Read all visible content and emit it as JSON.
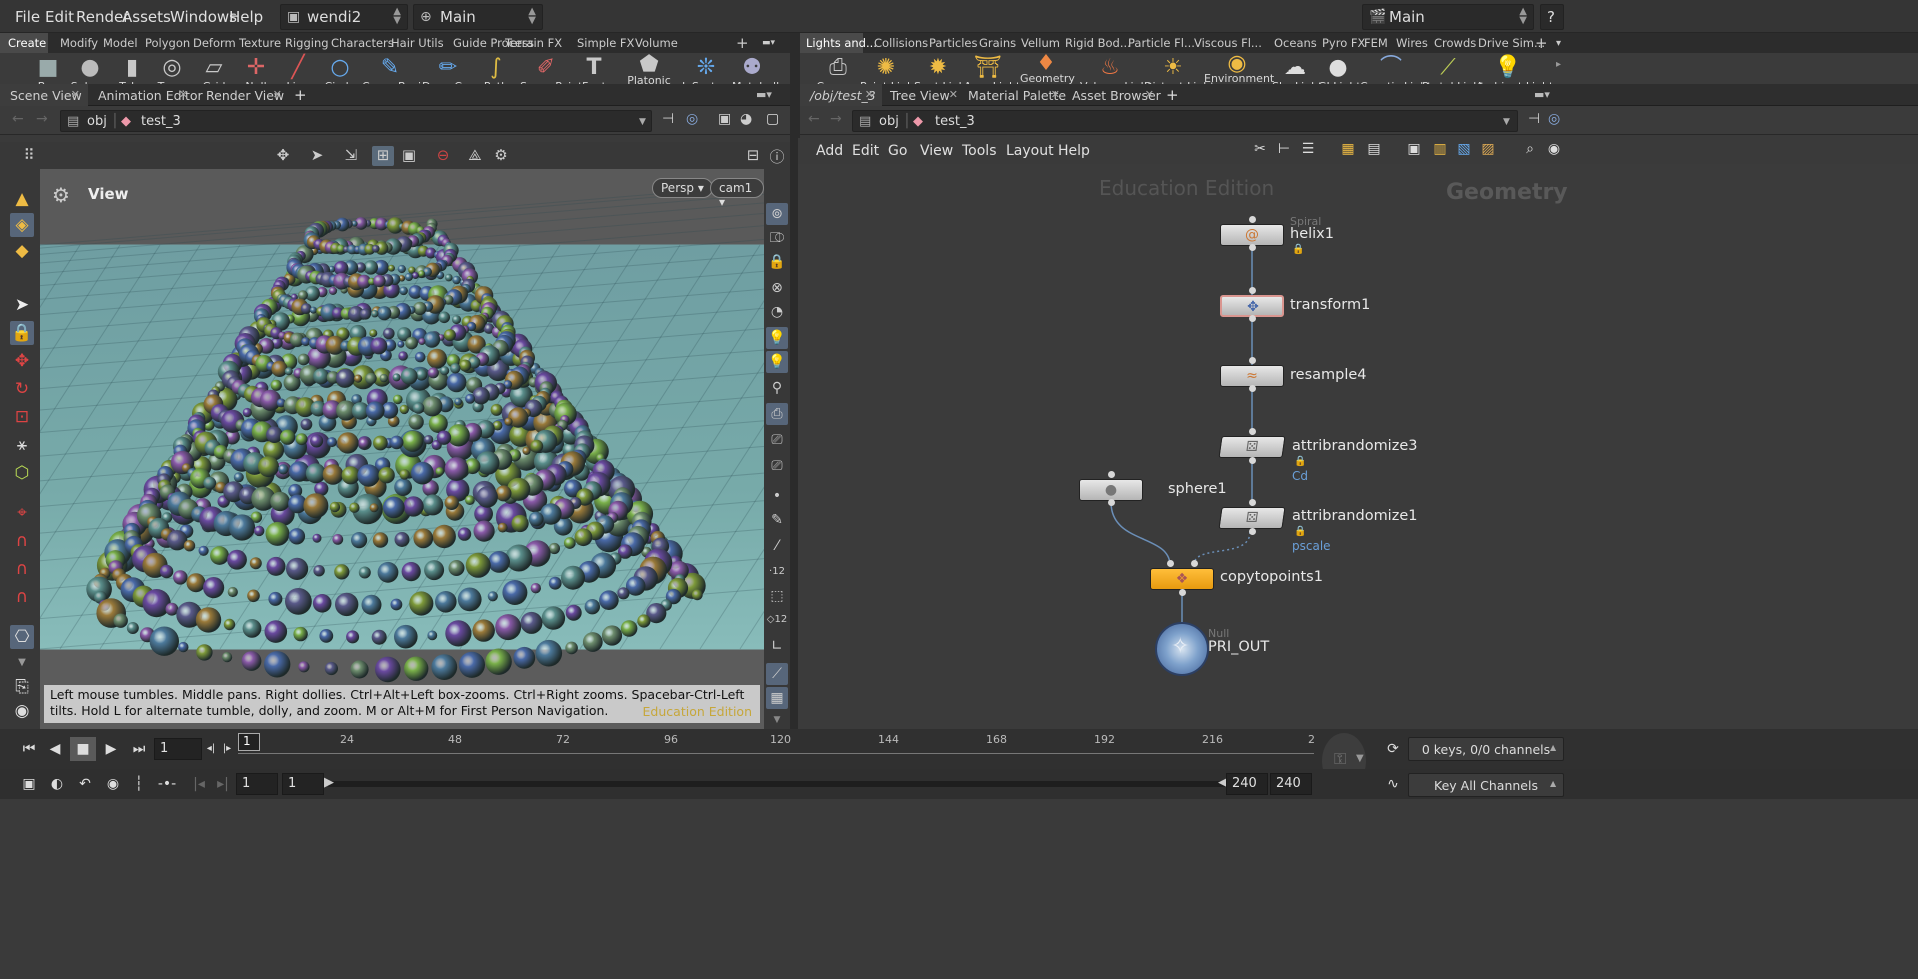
{
  "menubar": {
    "items": [
      "File",
      "Edit",
      "Render",
      "Assets",
      "Windows",
      "Help"
    ],
    "desktop_combo": "wendi2",
    "layout_combo": "Main",
    "right_combo": "Main",
    "help_icon": "?"
  },
  "shelf_left": {
    "tabs": [
      "Create",
      "Modify",
      "Model",
      "Polygon",
      "Deform",
      "Texture",
      "Rigging",
      "Characters",
      "Hair Utils",
      "Guide Process",
      "Terrain FX",
      "Simple FX",
      "Volume"
    ],
    "active_tab": "Create",
    "add": "+",
    "tools": [
      "Box",
      "Sphere",
      "Tube",
      "Torus",
      "Grid",
      "Null",
      "Line",
      "Circle",
      "Curve Bezier",
      "Draw Curve",
      "Path",
      "Spray Paint",
      "Font",
      "Platonic Solids",
      "L-System",
      "Metaball"
    ]
  },
  "shelf_right": {
    "tabs": [
      "Lights and...",
      "Collisions",
      "Particles",
      "Grains",
      "Vellum",
      "Rigid Bod...",
      "Particle Fl...",
      "Viscous Fl...",
      "Oceans",
      "Pyro FX",
      "FEM",
      "Wires",
      "Crowds",
      "Drive Sim..."
    ],
    "active_tab": "Lights and...",
    "add": "+",
    "tools": [
      "Camera",
      "Point Light",
      "Spot Light",
      "Area Light",
      "Geometry Light",
      "Volume Light",
      "Distant Light",
      "Environment Light",
      "Sky Light",
      "GI Light",
      "Caustic Light",
      "Portal Light",
      "Ambient Light"
    ]
  },
  "left_pane": {
    "tabs": [
      "Scene View",
      "Animation Editor",
      "Render View"
    ],
    "path_obj": "obj",
    "path_node": "test_3",
    "viewport_title": "View",
    "persp": "Persp",
    "cam": "cam1",
    "help_text": "Left mouse tumbles. Middle pans. Right dollies. Ctrl+Alt+Left box-zooms. Ctrl+Right zooms. Spacebar-Ctrl-Left tilts. Hold L for alternate tumble, dolly, and zoom. M or Alt+M for First Person Navigation.",
    "edu_label": "Education Edition"
  },
  "right_pane": {
    "tabs": [
      "/obj/test_3",
      "Tree View",
      "Material Palette",
      "Asset Browser"
    ],
    "path_obj": "obj",
    "path_node": "test_3",
    "menu": [
      "Add",
      "Edit",
      "Go",
      "View",
      "Tools",
      "Layout",
      "Help"
    ],
    "watermark": "Education Edition",
    "context_label": "Geometry"
  },
  "network": {
    "nodes": [
      {
        "id": "helix1",
        "name": "helix1",
        "type": "Spiral",
        "icon": "spiral-icon"
      },
      {
        "id": "transform1",
        "name": "transform1",
        "type": "",
        "icon": "transform-icon"
      },
      {
        "id": "resample4",
        "name": "resample4",
        "type": "",
        "icon": "resample-icon"
      },
      {
        "id": "attribrandomize3",
        "name": "attribrandomize3",
        "sub": "Cd",
        "icon": "dice-icon"
      },
      {
        "id": "attribrandomize1",
        "name": "attribrandomize1",
        "sub": "pscale",
        "icon": "dice-icon"
      },
      {
        "id": "sphere1",
        "name": "sphere1",
        "icon": "sphere-icon"
      },
      {
        "id": "copytopoints1",
        "name": "copytopoints1",
        "icon": "copy-icon"
      },
      {
        "id": "PRI_OUT",
        "name": "PRI_OUT",
        "type": "Null",
        "icon": "null-icon"
      }
    ]
  },
  "timeline": {
    "current_frame": "1",
    "ticks": [
      "24",
      "48",
      "72",
      "96",
      "120",
      "144",
      "168",
      "192",
      "216",
      "2"
    ],
    "start": "1",
    "start2": "1",
    "end": "240",
    "end2": "240",
    "keys_info": "0 keys, 0/0 channels",
    "key_all": "Key All Channels"
  },
  "colors": {
    "accent_tab": "#4a4a4a",
    "node_orange": "#f0a818",
    "link": "#6b8fb8"
  }
}
